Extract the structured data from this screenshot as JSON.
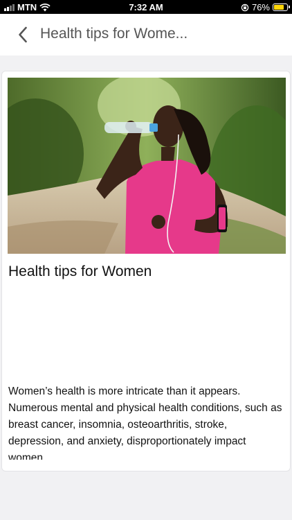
{
  "status_bar": {
    "carrier": "MTN",
    "time": "7:32 AM",
    "battery": "76%",
    "battery_level": 0.76,
    "battery_color": "#ffd60a"
  },
  "nav": {
    "title": "Health tips for Wome..."
  },
  "article": {
    "image_subject": "woman in pink shirt drinking water from bottle on forest path",
    "title": "Health tips for Women",
    "body": "Women’s health is more intricate than it appears. Numerous mental and physical health conditions, such as breast cancer, insomnia, osteoarthritis, stroke, depression, and anxiety, disproportionately impact women."
  }
}
